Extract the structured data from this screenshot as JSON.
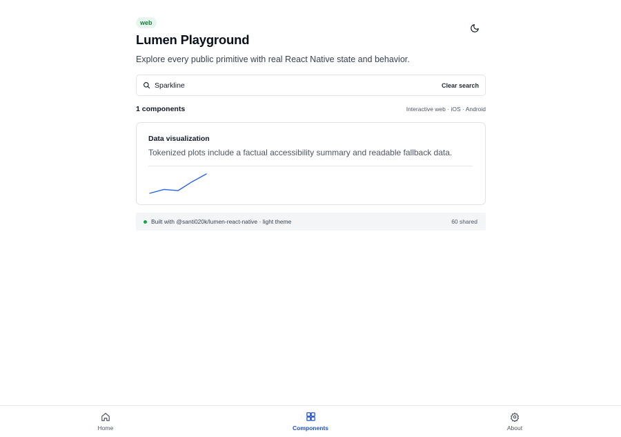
{
  "header": {
    "platform_badge": "web",
    "title": "Lumen Playground",
    "subtitle": "Explore every public primitive with real React Native state and behavior.",
    "theme_toggle_icon": "moon-icon"
  },
  "search": {
    "value": "Sparkline",
    "clear_label": "Clear search"
  },
  "results": {
    "count_label": "1 components",
    "platforms_label": "Interactive web · iOS · Android"
  },
  "card": {
    "title": "Data visualization",
    "description": "Tokenized plots include a factual accessibility summary and readable fallback data.",
    "sparkline": {
      "values": [
        2.0,
        3.0,
        2.7,
        5.0,
        7.0
      ],
      "color": "#2563eb"
    }
  },
  "footer": {
    "built_with": "Built with @santi020k/lumen-react-native · light theme",
    "shared_count": "60 shared",
    "status_color": "#16a34a"
  },
  "tabs": [
    {
      "label": "Home",
      "icon": "home-icon",
      "active": false
    },
    {
      "label": "Components",
      "icon": "components-icon",
      "active": true
    },
    {
      "label": "About",
      "icon": "gear-icon",
      "active": false
    }
  ],
  "colors": {
    "accent": "#1d4ed8",
    "badge_bg": "#e7f6ee",
    "badge_text": "#15803d"
  }
}
